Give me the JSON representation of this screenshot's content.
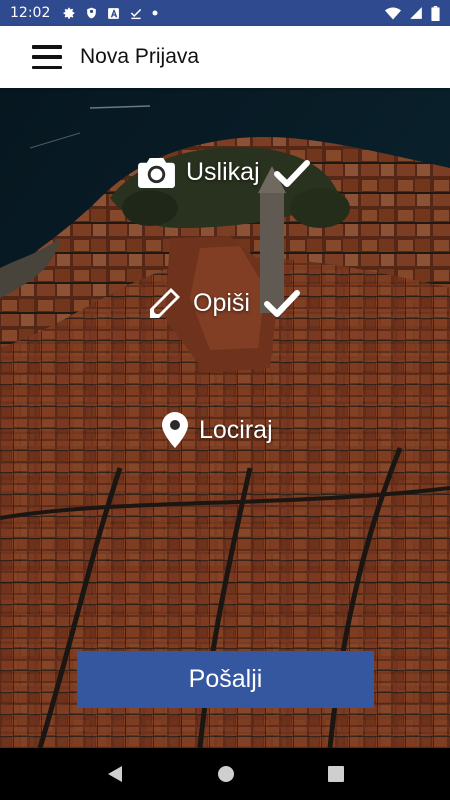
{
  "status_bar": {
    "time": "12:02",
    "left_icons": [
      "settings-icon",
      "shield-icon",
      "a-box-icon",
      "download-done-icon",
      "dot-icon"
    ],
    "right_icons": [
      "wifi-icon",
      "signal-icon",
      "battery-icon"
    ],
    "color": "#2f4a8f"
  },
  "app_bar": {
    "title": "Nova Prijava",
    "menu_icon": "menu-icon"
  },
  "actions": [
    {
      "label": "Uslikaj",
      "icon": "camera-icon",
      "completed": true
    },
    {
      "label": "Opiši",
      "icon": "pencil-icon",
      "completed": true
    },
    {
      "label": "Lociraj",
      "icon": "map-pin-icon",
      "completed": false
    }
  ],
  "submit": {
    "label": "Pošalji",
    "color": "#3557a0"
  },
  "nav_bar": {
    "buttons": [
      "back-icon",
      "home-icon",
      "recents-icon"
    ]
  },
  "background": {
    "description_icon": "aerial-town-photo",
    "roof_color": "#b5532e",
    "sea_color": "#0e2b3a"
  }
}
